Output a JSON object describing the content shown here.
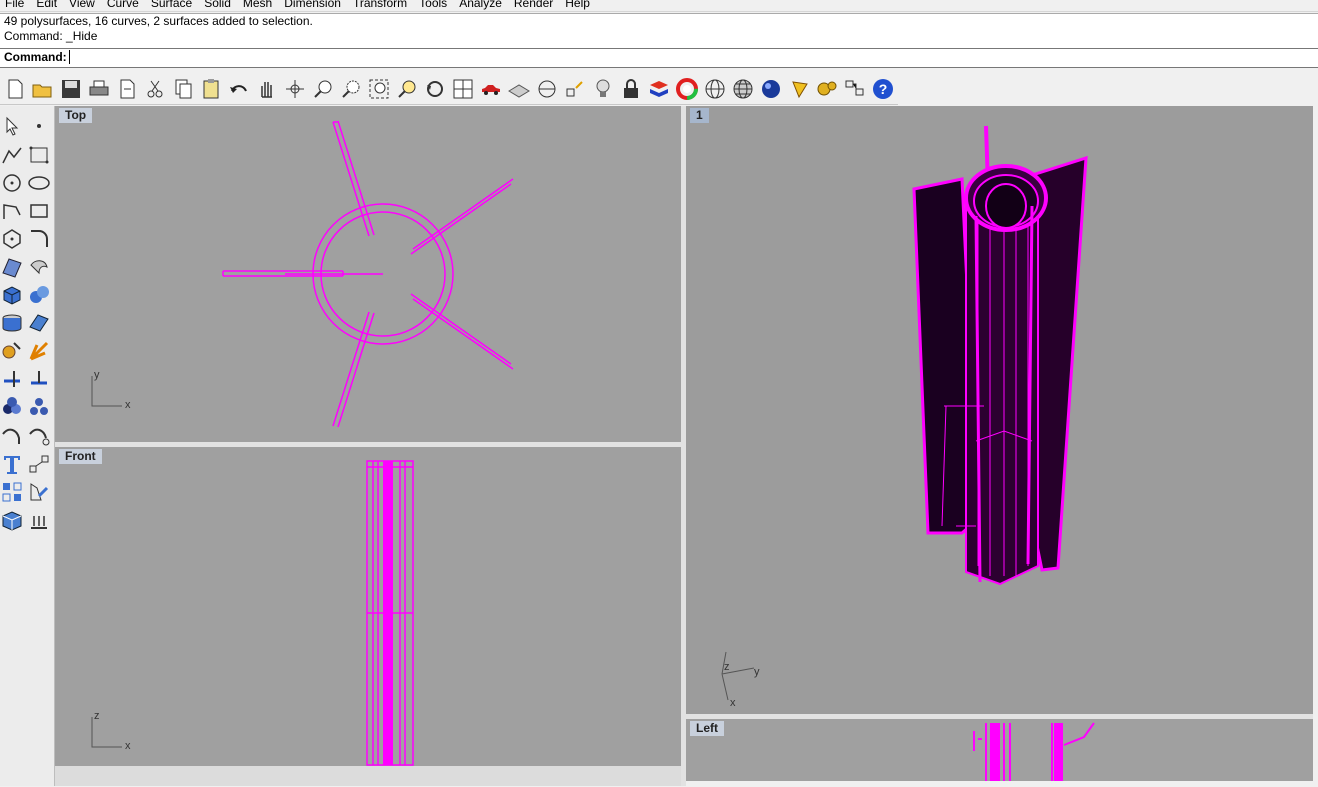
{
  "menu": [
    "File",
    "Edit",
    "View",
    "Curve",
    "Surface",
    "Solid",
    "Mesh",
    "Dimension",
    "Transform",
    "Tools",
    "Analyze",
    "Render",
    "Help"
  ],
  "history": [
    "49 polysurfaces, 16 curves, 2 surfaces added to selection.",
    "Command: _Hide"
  ],
  "command": {
    "label": "Command:",
    "value": ""
  },
  "toolbar_icons": [
    "new-file",
    "open-folder",
    "save",
    "print",
    "import",
    "cut",
    "copy",
    "paste",
    "undo",
    "pan-hand",
    "rotate-view",
    "zoom",
    "zoom-window",
    "zoom-extents",
    "zoom-selected",
    "undo-view",
    "four-viewports",
    "car-render",
    "grid",
    "circle-point",
    "snap",
    "light-bulb",
    "lock",
    "layers",
    "color-wheel",
    "wireframe-sphere",
    "shaded-sphere",
    "render-sphere",
    "camera-cone",
    "gears-settings",
    "properties",
    "help"
  ],
  "sidebar_icons": [
    "select-arrow",
    "point",
    "polyline",
    "curve-rect",
    "circle",
    "ellipse",
    "arc",
    "rectangle",
    "polygon",
    "fillet-curve",
    "surface-patch",
    "revolve",
    "box",
    "sphere",
    "cylinder",
    "plane",
    "transform-gear",
    "explode",
    "split",
    "trim",
    "boolean",
    "array",
    "curve-tools",
    "offset",
    "text",
    "dimension",
    "grid-array",
    "edit",
    "box-shade",
    "hatch"
  ],
  "viewports": {
    "top": {
      "title": "Top",
      "axis_x": "x",
      "axis_y": "y"
    },
    "front": {
      "title": "Front",
      "axis_x": "x",
      "axis_y": "z"
    },
    "persp": {
      "title": "1",
      "axis_x": "x",
      "axis_y": "y",
      "axis_z": "z"
    },
    "left": {
      "title": "Left"
    }
  },
  "colors": {
    "selection": "#ff00ff",
    "viewport_bg": "#a0a0a0",
    "persp_bg": "#9c9c9c",
    "title_bg": "#c8d0dc"
  }
}
